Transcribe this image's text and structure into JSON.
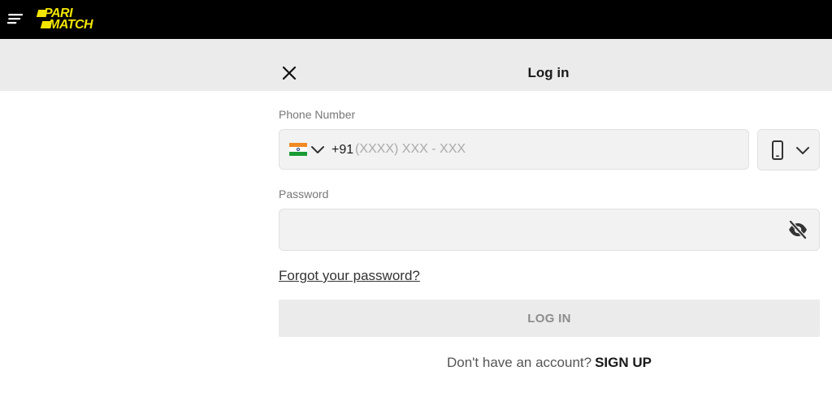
{
  "header": {
    "brand_line1": "PARI",
    "brand_line2": "MATCH",
    "brand_color": "#f2e500",
    "menu_icon": "hamburger-menu-icon"
  },
  "modal": {
    "title": "Log in",
    "close_icon": "close-icon"
  },
  "form": {
    "phone_label": "Phone Number",
    "country_flag": "india-flag-icon",
    "country_code": "+91",
    "phone_placeholder": "(XXXX) XXX - XXX",
    "phone_value": "",
    "login_method_icon": "mobile-phone-icon",
    "password_label": "Password",
    "password_value": "",
    "password_visibility_icon": "eye-slash-icon",
    "forgot_password": "Forgot your password?",
    "login_button": "LOG IN",
    "no_account_text": "Don't have an account?",
    "signup_link": "SIGN UP"
  },
  "colors": {
    "topbar": "#000000",
    "header_bg": "#ebebeb",
    "field_bg": "#f2f2f2",
    "button_disabled_bg": "#ebebeb",
    "button_disabled_text": "#8c8c8c"
  }
}
